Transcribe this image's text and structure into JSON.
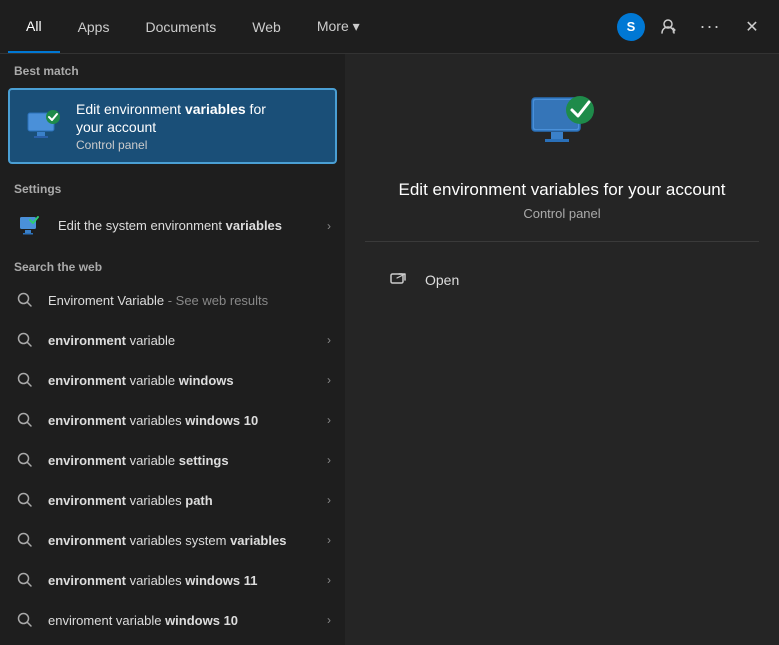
{
  "nav": {
    "tabs": [
      {
        "label": "All",
        "active": true
      },
      {
        "label": "Apps",
        "active": false
      },
      {
        "label": "Documents",
        "active": false
      },
      {
        "label": "Web",
        "active": false
      },
      {
        "label": "More ▾",
        "active": false
      }
    ],
    "user_initial": "S",
    "feedback_tooltip": "Feedback",
    "more_tooltip": "More",
    "close_tooltip": "Close"
  },
  "left": {
    "best_match_label": "Best match",
    "best_match": {
      "title_part1": "Edit environment ",
      "title_bold": "variables",
      "title_part2": " for your account",
      "subtitle": "Control panel"
    },
    "settings_label": "Settings",
    "settings_item": {
      "text_pre": "Edit the system environment ",
      "text_bold": "variables"
    },
    "web_label": "Search the web",
    "web_items": [
      {
        "pre": "Enviroment Variable",
        "bold": "",
        "suffix": " - See web results",
        "has_chevron": false
      },
      {
        "pre": "",
        "bold": "environment",
        "suffix": " variable",
        "has_chevron": true
      },
      {
        "pre": "",
        "bold": "environment",
        "suffix": " variable ",
        "bold2": "windows",
        "has_chevron": true
      },
      {
        "pre": "",
        "bold": "environment",
        "suffix": " variables ",
        "bold2": "windows 10",
        "has_chevron": true
      },
      {
        "pre": "",
        "bold": "environment",
        "suffix": " variable ",
        "bold2": "settings",
        "has_chevron": true
      },
      {
        "pre": "",
        "bold": "environment",
        "suffix": " variables ",
        "bold2": "path",
        "has_chevron": true
      },
      {
        "pre": "",
        "bold": "environment",
        "suffix": " variables system ",
        "bold2": "variables",
        "has_chevron": true
      },
      {
        "pre": "",
        "bold": "environment",
        "suffix": " variables ",
        "bold2": "windows 11",
        "has_chevron": true
      },
      {
        "pre": "enviroment variable ",
        "bold": "windows 10",
        "suffix": "",
        "has_chevron": true
      }
    ]
  },
  "right": {
    "title": "Edit environment variables for your account",
    "subtitle": "Control panel",
    "open_label": "Open"
  }
}
